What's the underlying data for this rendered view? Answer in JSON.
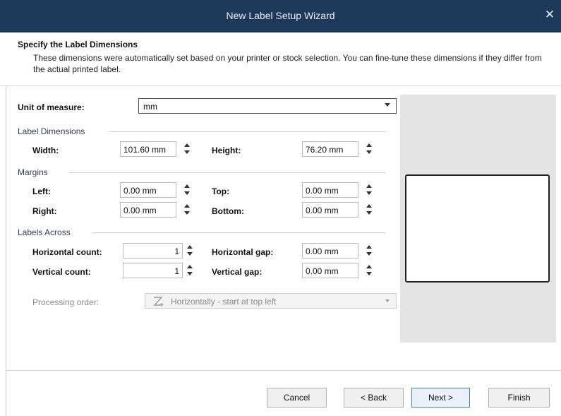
{
  "window": {
    "title": "New Label Setup Wizard",
    "close_icon": "close-icon"
  },
  "header": {
    "title": "Specify the Label Dimensions",
    "description": "These dimensions were automatically set based on your printer or stock selection. You can fine-tune these dimensions if they differ from the actual printed label."
  },
  "unit": {
    "label": "Unit of measure:",
    "value": "mm"
  },
  "label_dimensions": {
    "heading": "Label Dimensions",
    "width_label": "Width:",
    "width_value": "101.60 mm",
    "height_label": "Height:",
    "height_value": "76.20 mm"
  },
  "margins": {
    "heading": "Margins",
    "left_label": "Left:",
    "left_value": "0.00 mm",
    "top_label": "Top:",
    "top_value": "0.00 mm",
    "right_label": "Right:",
    "right_value": "0.00 mm",
    "bottom_label": "Bottom:",
    "bottom_value": "0.00 mm"
  },
  "labels_across": {
    "heading": "Labels Across",
    "hcount_label": "Horizontal count:",
    "hcount_value": "1",
    "hgap_label": "Horizontal gap:",
    "hgap_value": "0.00 mm",
    "vcount_label": "Vertical count:",
    "vcount_value": "1",
    "vgap_label": "Vertical gap:",
    "vgap_value": "0.00 mm"
  },
  "processing": {
    "label": "Processing order:",
    "value": "Horizontally - start at top left",
    "icon": "z-order-icon",
    "enabled": false
  },
  "buttons": {
    "cancel": "Cancel",
    "back": "< Back",
    "next": "Next >",
    "finish": "Finish"
  },
  "colors": {
    "titlebar": "#1d3a5a",
    "preview_bg": "#e4e4e4",
    "section_heading": "#2a3d5c"
  }
}
